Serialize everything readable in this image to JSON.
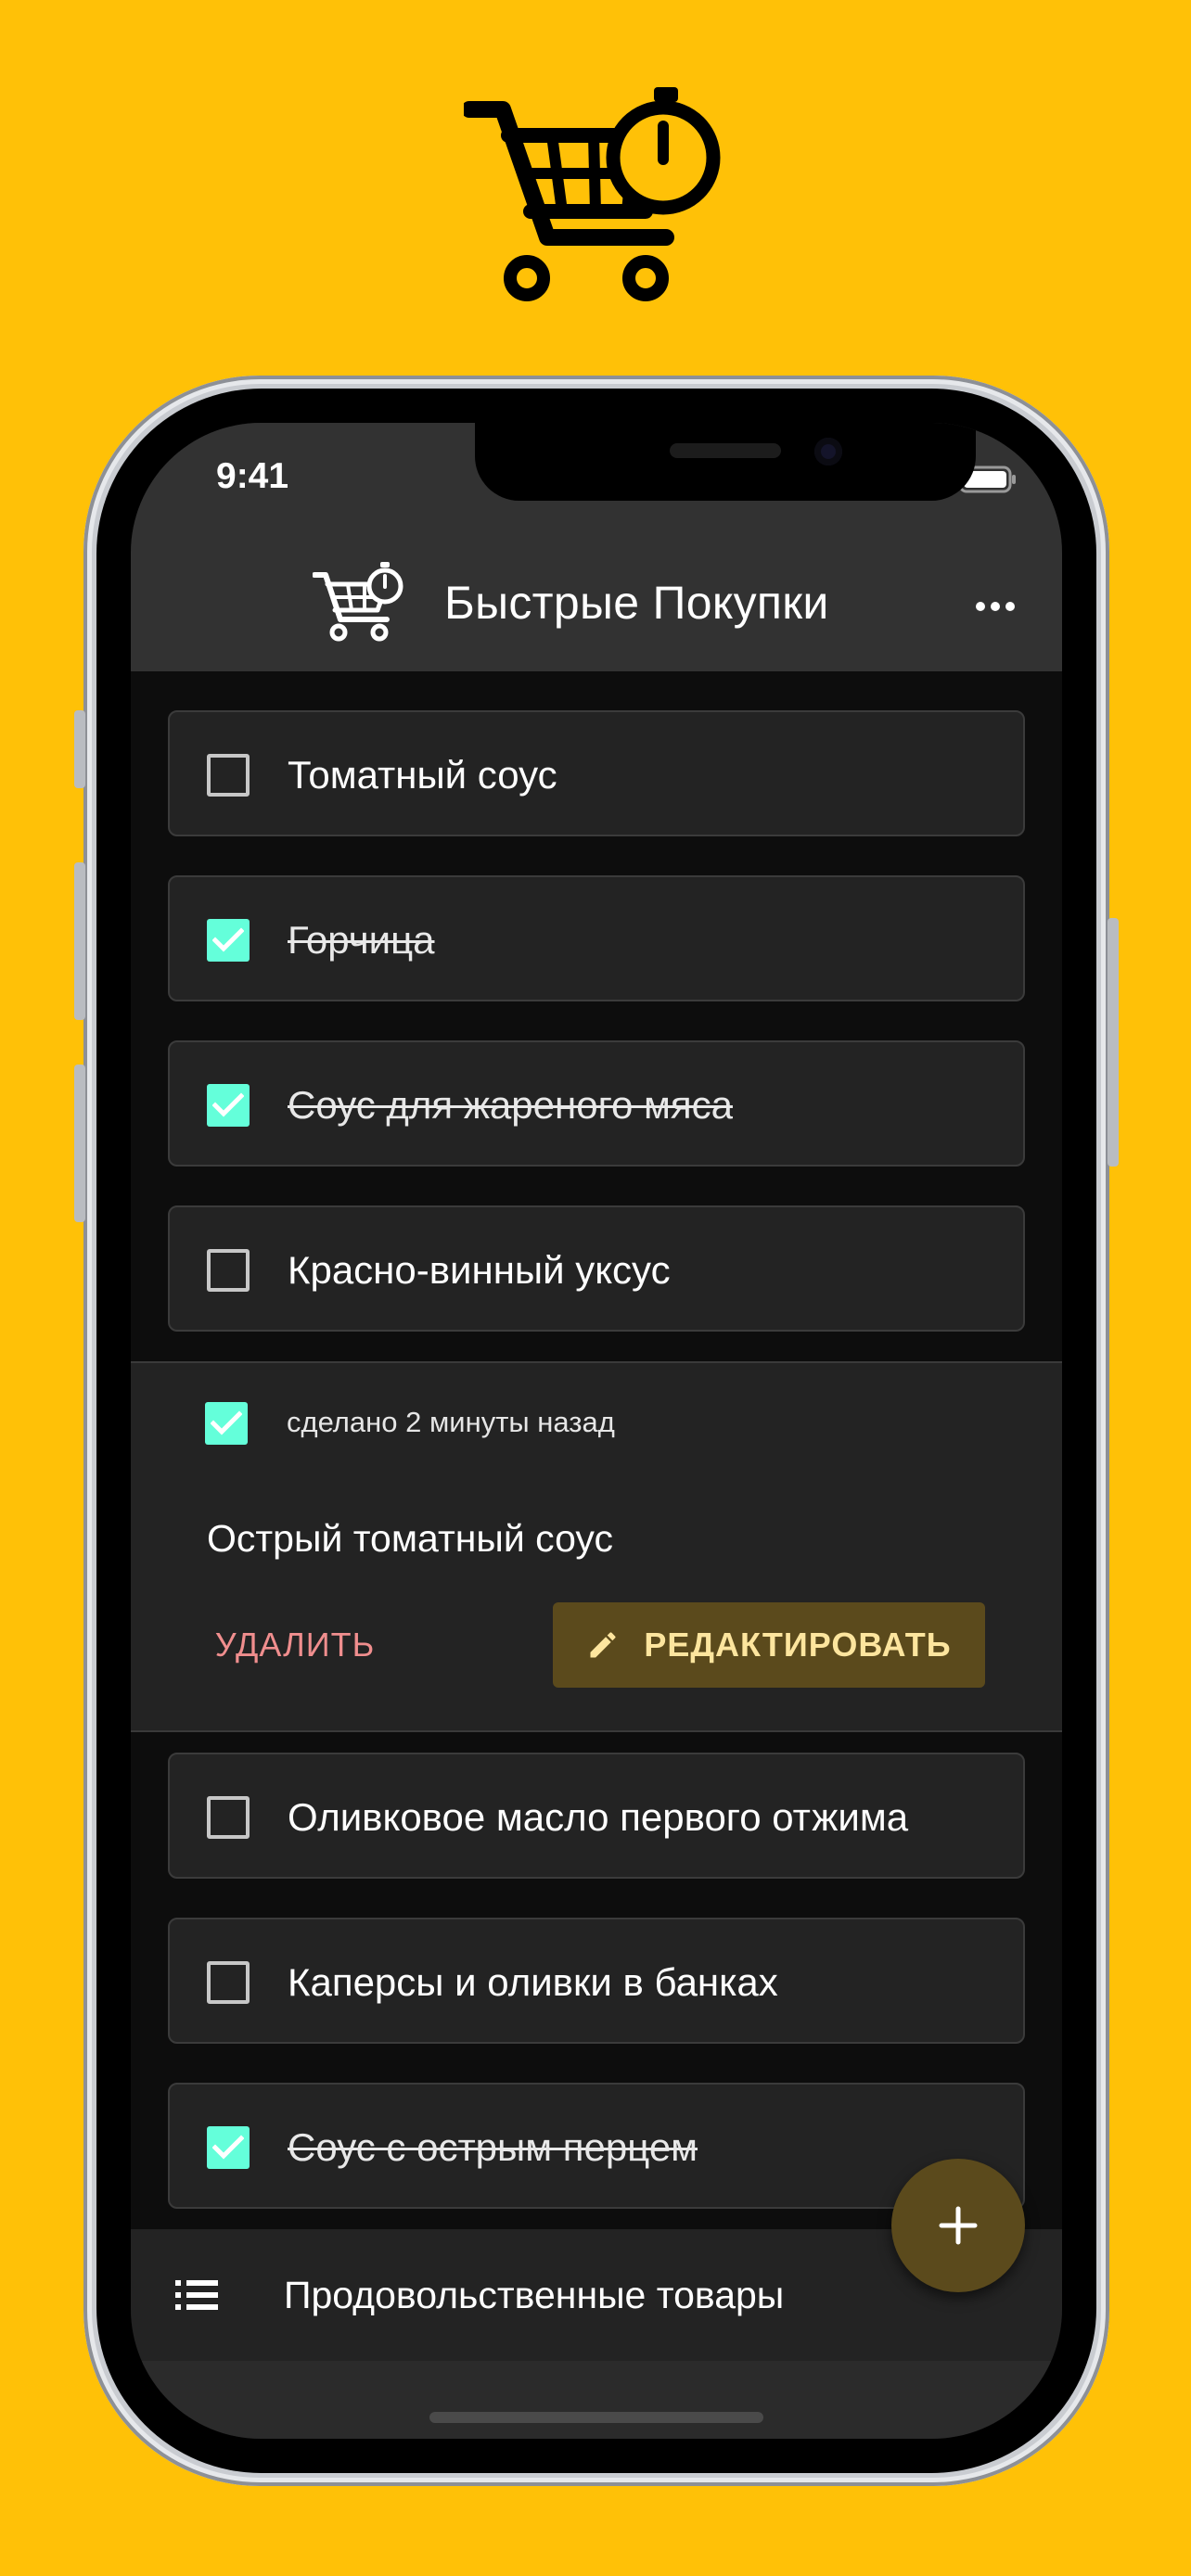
{
  "status_bar": {
    "time": "9:41"
  },
  "app_bar": {
    "title": "Быстрые Покупки"
  },
  "items": [
    {
      "label": "Томатный соус",
      "checked": false
    },
    {
      "label": "Горчица",
      "checked": true
    },
    {
      "label": "Соус для жареного мяса",
      "checked": true
    },
    {
      "label": "Красно-винный уксус",
      "checked": false
    }
  ],
  "expanded_item": {
    "checked": true,
    "done_time": "сделано 2 минуты назад",
    "title": "Острый томатный соус",
    "delete_label": "УДАЛИТЬ",
    "edit_label": "РЕДАКТИРОВАТЬ"
  },
  "items_after": [
    {
      "label": "Оливковое масло первого отжима",
      "checked": false
    },
    {
      "label": "Каперсы и оливки в банках",
      "checked": false
    },
    {
      "label": "Соус с острым перцем",
      "checked": true
    }
  ],
  "bottom_bar": {
    "list_name": "Продовольственные товары"
  },
  "colors": {
    "background": "#FFC107",
    "accent": "#64FFDA",
    "fab": "#5B4A1C",
    "delete": "#F08E8E"
  },
  "icons": [
    "cart-timer-icon",
    "more-icon",
    "checkbox-icon",
    "pencil-icon",
    "list-icon",
    "plus-icon",
    "wifi-icon",
    "battery-icon"
  ]
}
